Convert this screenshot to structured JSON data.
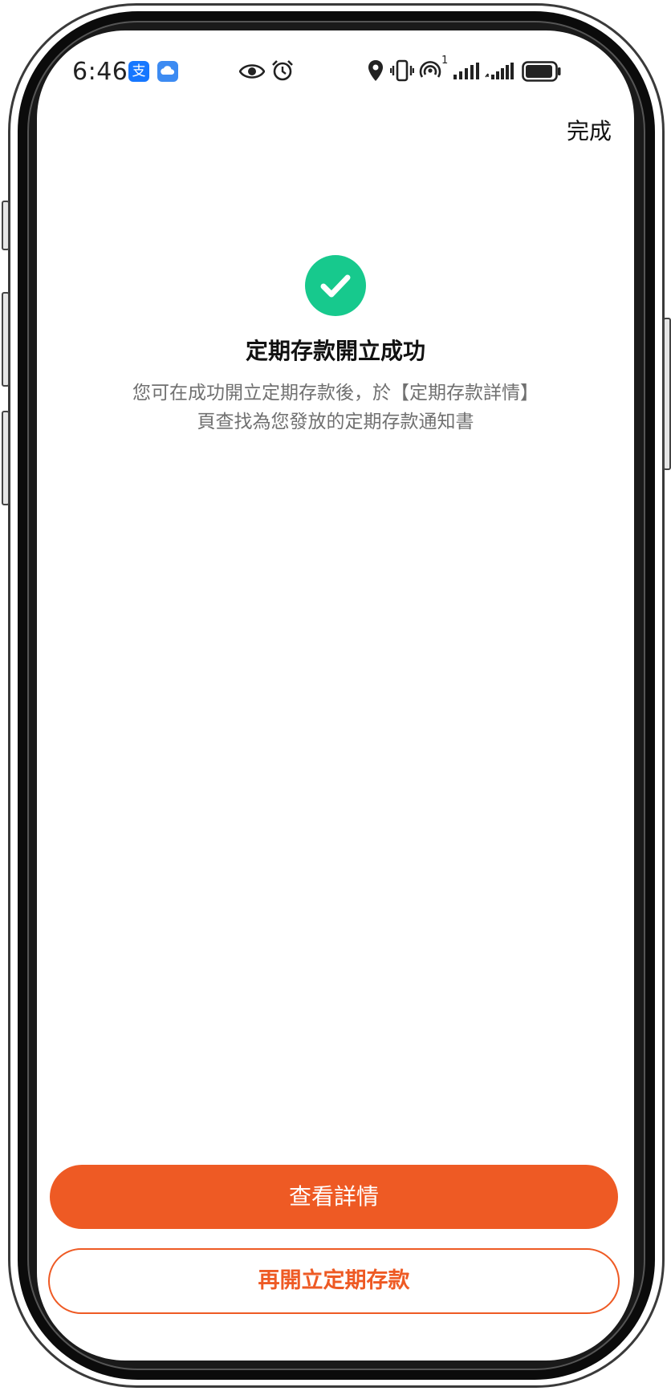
{
  "status_bar": {
    "time": "6:46",
    "icons": [
      "alipay-icon",
      "cloud-icon",
      "eye-icon",
      "alarm-icon",
      "location-icon",
      "vibrate-icon",
      "hotspot-icon",
      "signal-icon",
      "signal-icon",
      "battery-icon"
    ],
    "hotspot_superscript": "1",
    "colors": {
      "alipay": "#1677ff",
      "cloud": "#3d8bf2"
    },
    "alipay_glyph": "支"
  },
  "header": {
    "done_label": "完成"
  },
  "result": {
    "icon": "check-circle-icon",
    "icon_color": "#17c98d",
    "title": "定期存款開立成功",
    "description_line1": "您可在成功開立定期存款後，於【定期存款詳情】",
    "description_line2": "頁查找為您發放的定期存款通知書"
  },
  "actions": {
    "primary_label": "查看詳情",
    "secondary_label": "再開立定期存款",
    "accent_color": "#ee5a24"
  }
}
